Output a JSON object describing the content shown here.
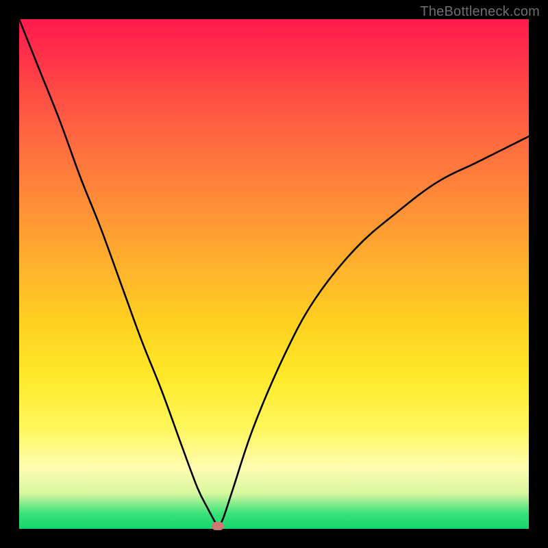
{
  "watermark": "TheBottleneck.com",
  "colors": {
    "frame": "#000000",
    "curve": "#000000",
    "dot": "#cc7a72"
  },
  "chart_data": {
    "type": "line",
    "title": "",
    "xlabel": "",
    "ylabel": "",
    "xlim": [
      0,
      100
    ],
    "ylim": [
      0,
      100
    ],
    "grid": false,
    "note": "Values are approximate percentages read from the figure. The vertical axis represents bottleneck severity (high at top = red, zero at bottom = green). The curve drops to a minimum near x≈39 and rises on both sides.",
    "minimum_marker": {
      "x": 39,
      "y": 0.5
    },
    "series": [
      {
        "name": "bottleneck-curve",
        "x": [
          0,
          4,
          8,
          12,
          16,
          20,
          24,
          28,
          32,
          35,
          37,
          38.5,
          39,
          40,
          42,
          46,
          52,
          58,
          66,
          74,
          82,
          90,
          100
        ],
        "values": [
          100,
          90,
          80,
          69,
          59,
          48,
          37,
          27,
          16,
          8,
          4,
          1.2,
          0.5,
          2,
          8,
          20,
          34,
          45,
          55,
          62,
          68,
          72,
          77
        ]
      }
    ]
  }
}
